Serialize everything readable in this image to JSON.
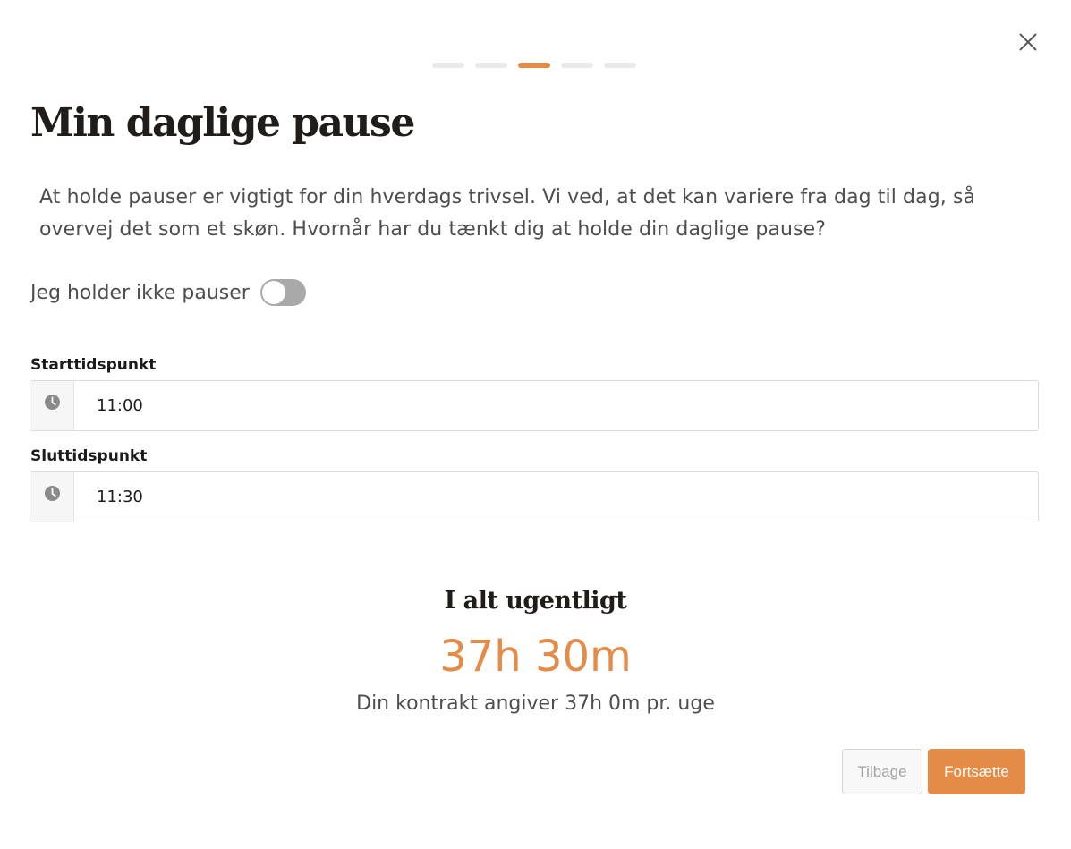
{
  "dialog": {
    "close_icon": "close-icon",
    "steps": {
      "total": 5,
      "current": 3,
      "active_color": "#e38b47"
    },
    "title": "Min daglige pause",
    "description": "At holde pauser er vigtigt for din hverdags trivsel. Vi ved, at det kan variere fra dag til dag, så overvej det som et skøn. Hvornår har du tænkt dig at holde din daglige pause?",
    "no_breaks_toggle": {
      "label": "Jeg holder ikke pauser",
      "checked": false
    },
    "start_time": {
      "label": "Starttidspunkt",
      "value": "11:00",
      "icon": "clock-icon"
    },
    "end_time": {
      "label": "Sluttidspunkt",
      "value": "11:30",
      "icon": "clock-icon"
    },
    "summary": {
      "title": "I alt ugentligt",
      "value": "37h 30m",
      "note": "Din kontrakt angiver 37h 0m pr. uge"
    },
    "buttons": {
      "back": "Tilbage",
      "next": "Fortsætte"
    },
    "colors": {
      "accent": "#e38b47",
      "toggle_off": "#a9a9a9"
    }
  }
}
